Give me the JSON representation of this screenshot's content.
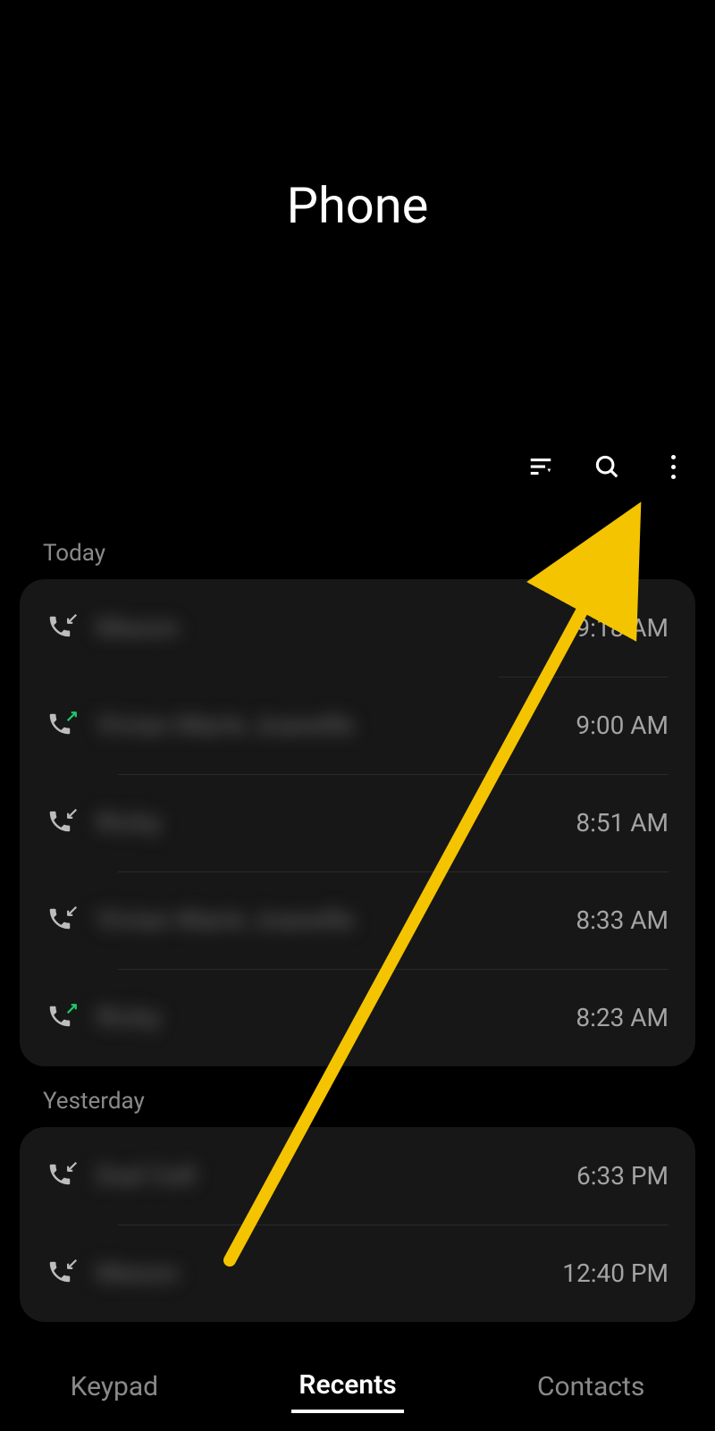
{
  "header": {
    "title": "Phone"
  },
  "toolbar": {
    "filter_icon": "filter-icon",
    "search_icon": "search-icon",
    "more_icon": "more-icon"
  },
  "sections": {
    "today_label": "Today",
    "yesterday_label": "Yesterday"
  },
  "calls_today": [
    {
      "name": "Mason",
      "time": "9:18 AM",
      "direction": "in"
    },
    {
      "name": "Vivian Marie Joanelle",
      "time": "9:00 AM",
      "direction": "out"
    },
    {
      "name": "Ricky",
      "time": "8:51 AM",
      "direction": "in"
    },
    {
      "name": "Vivian Marie Joanelle",
      "time": "8:33 AM",
      "direction": "in"
    },
    {
      "name": "Ricky",
      "time": "8:23 AM",
      "direction": "out"
    }
  ],
  "calls_yesterday": [
    {
      "name": "Dad Cell",
      "time": "6:33 PM",
      "direction": "in"
    },
    {
      "name": "Mason",
      "time": "12:40 PM",
      "direction": "in"
    }
  ],
  "nav": {
    "keypad": "Keypad",
    "recents": "Recents",
    "contacts": "Contacts",
    "active": "recents"
  },
  "annotation": {
    "arrow_color": "#f5c400"
  }
}
